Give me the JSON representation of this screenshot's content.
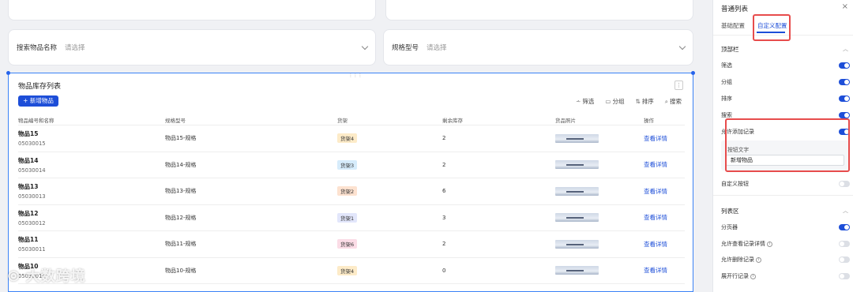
{
  "filters": [
    {
      "label": "搜索物品名称",
      "placeholder": "请选择"
    },
    {
      "label": "规格型号",
      "placeholder": "请选择"
    }
  ],
  "list": {
    "title": "物品库存列表",
    "add_button": "+ 新增物品",
    "toolbar": {
      "filter": "筛选",
      "group": "分组",
      "sort": "排序",
      "search": "搜索"
    },
    "columns": [
      "物品编号和名称",
      "规格型号",
      "货架",
      "剩余库存",
      "货品照片",
      "操作"
    ],
    "rows": [
      {
        "name": "物品15",
        "code": "05030015",
        "spec": "物品15-规格",
        "shelf": "货架4",
        "shelf_color": "#fdebc8",
        "stock": "2",
        "action": "查看详情"
      },
      {
        "name": "物品14",
        "code": "05030014",
        "spec": "物品14-规格",
        "shelf": "货架3",
        "shelf_color": "#d6ecfb",
        "stock": "2",
        "action": "查看详情"
      },
      {
        "name": "物品13",
        "code": "05030013",
        "spec": "物品13-规格",
        "shelf": "货架2",
        "shelf_color": "#fde2d0",
        "stock": "6",
        "action": "查看详情"
      },
      {
        "name": "物品12",
        "code": "05030012",
        "spec": "物品12-规格",
        "shelf": "货架1",
        "shelf_color": "#e2e6fb",
        "stock": "3",
        "action": "查看详情"
      },
      {
        "name": "物品11",
        "code": "05030011",
        "spec": "物品11-规格",
        "shelf": "货架6",
        "shelf_color": "#fbdce6",
        "stock": "2",
        "action": "查看详情"
      },
      {
        "name": "物品10",
        "code": "05030010",
        "spec": "物品10-规格",
        "shelf": "货架4",
        "shelf_color": "#fdebc8",
        "stock": "0",
        "action": "查看详情"
      }
    ]
  },
  "panel": {
    "title": "普通列表",
    "close": "×",
    "tabs": [
      "基础配置",
      "自定义配置"
    ],
    "top_section": "顶部栏",
    "top_items": [
      {
        "label": "筛选",
        "on": true
      },
      {
        "label": "分组",
        "on": true
      },
      {
        "label": "排序",
        "on": true
      },
      {
        "label": "搜索",
        "on": true
      },
      {
        "label": "允许添加记录",
        "on": true
      }
    ],
    "button_text_label": "按钮文字",
    "button_text_value": "新增物品",
    "custom_button": {
      "label": "自定义按钮",
      "on": false
    },
    "list_section": "列表区",
    "list_items": [
      {
        "label": "分页器",
        "on": true,
        "info": false
      },
      {
        "label": "允许查看记录详情",
        "on": false,
        "info": true
      },
      {
        "label": "允许删除记录",
        "on": false,
        "info": true
      },
      {
        "label": "展开行记录",
        "on": false,
        "info": true
      }
    ]
  },
  "watermark": "大数跨境",
  "colors": {
    "accent": "#1d4ed8",
    "highlight": "#e74c4c"
  }
}
